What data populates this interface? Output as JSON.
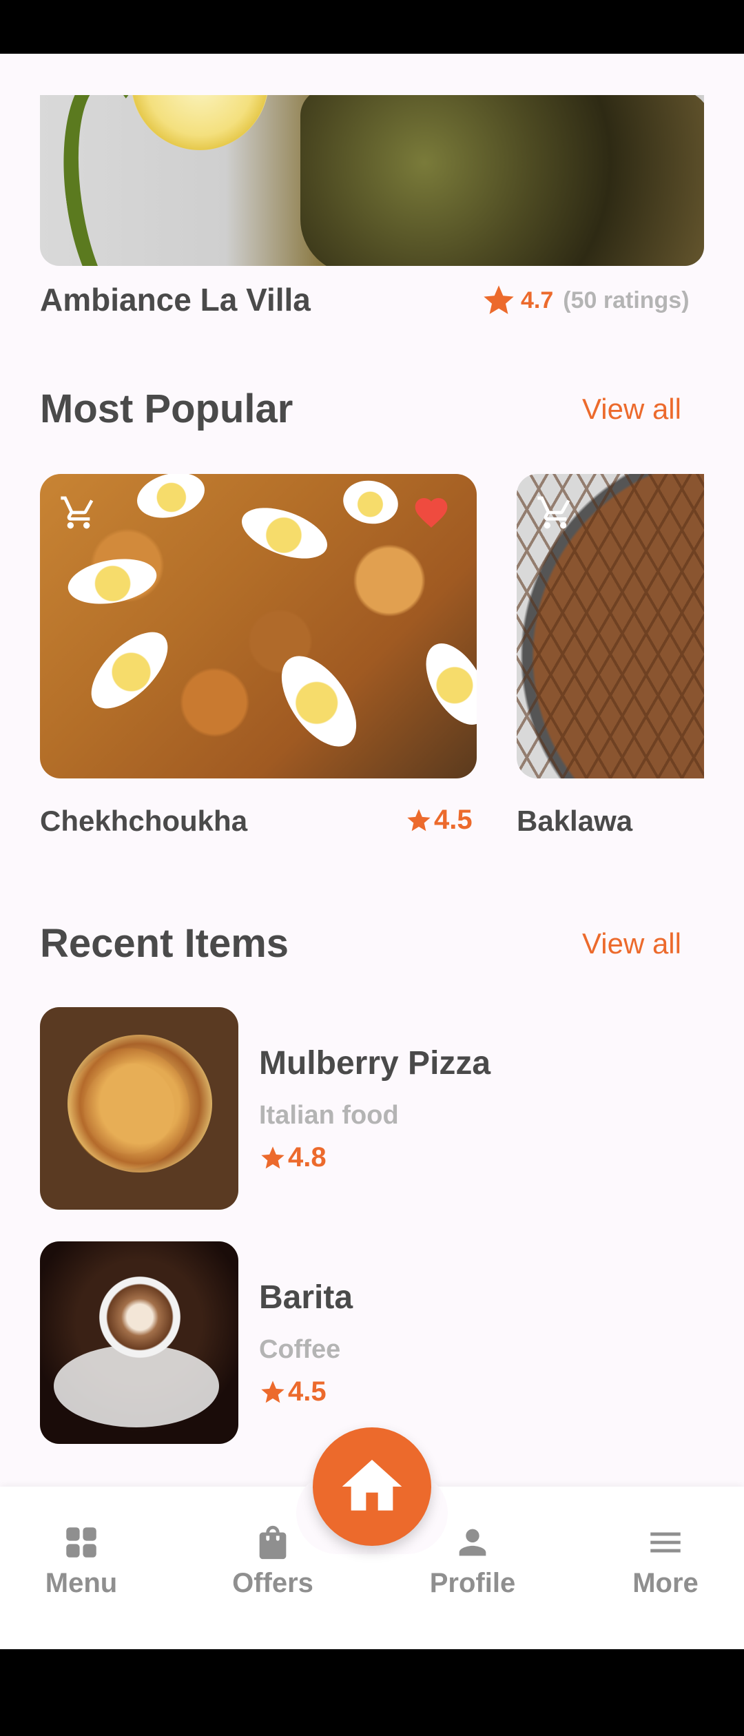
{
  "restaurant": {
    "name": "Ambiance La Villa",
    "rating": "4.7",
    "ratings_count": "(50 ratings)"
  },
  "most_popular": {
    "title": "Most Popular",
    "view_all": "View all",
    "items": [
      {
        "name": "Chekhchoukha",
        "rating": "4.5",
        "favorite": true
      },
      {
        "name": "Baklawa"
      }
    ]
  },
  "recent_items": {
    "title": "Recent Items",
    "view_all": "View all",
    "items": [
      {
        "name": "Mulberry Pizza",
        "category": "Italian food",
        "rating": "4.8"
      },
      {
        "name": "Barita",
        "category": "Coffee",
        "rating": "4.5"
      }
    ]
  },
  "tabs": [
    {
      "label": "Menu",
      "icon": "grid-icon"
    },
    {
      "label": "Offers",
      "icon": "bag-icon"
    },
    {
      "label": "Home",
      "icon": "home-icon"
    },
    {
      "label": "Profile",
      "icon": "person-icon"
    },
    {
      "label": "More",
      "icon": "menu-icon"
    }
  ],
  "colors": {
    "accent": "#ec6a2c",
    "text": "#4a4a4a",
    "muted": "#b4b4b4",
    "background": "#fdf9fd"
  }
}
